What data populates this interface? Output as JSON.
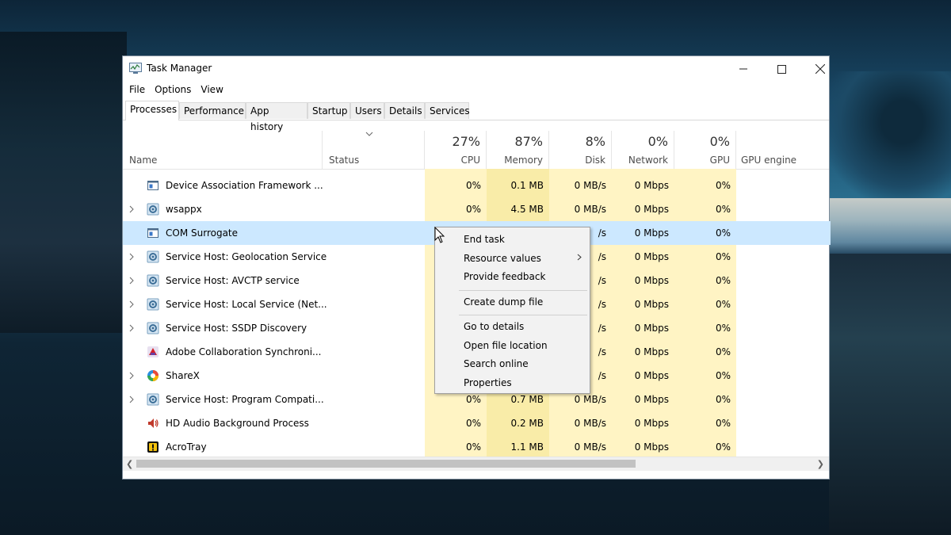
{
  "window": {
    "title": "Task Manager"
  },
  "menu": [
    "File",
    "Options",
    "View"
  ],
  "tabs": [
    "Processes",
    "Performance",
    "App history",
    "Startup",
    "Users",
    "Details",
    "Services"
  ],
  "columns": {
    "name": "Name",
    "status": "Status",
    "cpu": {
      "pct": "27%",
      "label": "CPU"
    },
    "memory": {
      "pct": "87%",
      "label": "Memory"
    },
    "disk": {
      "pct": "8%",
      "label": "Disk"
    },
    "network": {
      "pct": "0%",
      "label": "Network"
    },
    "gpu": {
      "pct": "0%",
      "label": "GPU"
    },
    "gpu_engine": "GPU engine"
  },
  "rows": [
    {
      "name": "Device Association Framework ...",
      "cpu": "0%",
      "memory": "0.1 MB",
      "disk": "0 MB/s",
      "network": "0 Mbps",
      "gpu": "0%",
      "icon": "window-icon",
      "expand": false
    },
    {
      "name": "wsappx",
      "cpu": "0%",
      "memory": "4.5 MB",
      "disk": "0 MB/s",
      "network": "0 Mbps",
      "gpu": "0%",
      "icon": "gear-icon",
      "expand": true
    },
    {
      "name": "COM Surrogate",
      "cpu": "",
      "memory": "",
      "disk": "/s",
      "network": "0 Mbps",
      "gpu": "0%",
      "icon": "window-icon",
      "expand": false,
      "selected": true
    },
    {
      "name": "Service Host: Geolocation Service",
      "cpu": "",
      "memory": "",
      "disk": "/s",
      "network": "0 Mbps",
      "gpu": "0%",
      "icon": "gear-icon",
      "expand": true
    },
    {
      "name": "Service Host: AVCTP service",
      "cpu": "",
      "memory": "",
      "disk": "/s",
      "network": "0 Mbps",
      "gpu": "0%",
      "icon": "gear-icon",
      "expand": true
    },
    {
      "name": "Service Host: Local Service (Net...",
      "cpu": "",
      "memory": "",
      "disk": "/s",
      "network": "0 Mbps",
      "gpu": "0%",
      "icon": "gear-icon",
      "expand": true
    },
    {
      "name": "Service Host: SSDP Discovery",
      "cpu": "",
      "memory": "",
      "disk": "/s",
      "network": "0 Mbps",
      "gpu": "0%",
      "icon": "gear-icon",
      "expand": true
    },
    {
      "name": "Adobe Collaboration Synchroni...",
      "cpu": "",
      "memory": "",
      "disk": "/s",
      "network": "0 Mbps",
      "gpu": "0%",
      "icon": "adobe-icon",
      "expand": false
    },
    {
      "name": "ShareX",
      "cpu": "",
      "memory": "",
      "disk": "/s",
      "network": "0 Mbps",
      "gpu": "0%",
      "icon": "sharex-icon",
      "expand": true
    },
    {
      "name": "Service Host: Program Compati...",
      "cpu": "0%",
      "memory": "0.7 MB",
      "disk": "0 MB/s",
      "network": "0 Mbps",
      "gpu": "0%",
      "icon": "gear-icon",
      "expand": true
    },
    {
      "name": "HD Audio Background Process",
      "cpu": "0%",
      "memory": "0.2 MB",
      "disk": "0 MB/s",
      "network": "0 Mbps",
      "gpu": "0%",
      "icon": "speaker-icon",
      "expand": false
    },
    {
      "name": "AcroTray",
      "cpu": "0%",
      "memory": "1.1 MB",
      "disk": "0 MB/s",
      "network": "0 Mbps",
      "gpu": "0%",
      "icon": "acrotray-icon",
      "expand": false
    }
  ],
  "context_menu": {
    "items": [
      {
        "label": "End task"
      },
      {
        "label": "Resource values",
        "submenu": true
      },
      {
        "label": "Provide feedback"
      },
      {
        "label": "Create dump file"
      },
      {
        "label": "Go to details"
      },
      {
        "label": "Open file location"
      },
      {
        "label": "Search online"
      },
      {
        "label": "Properties"
      }
    ]
  },
  "colors": {
    "selected_row": "#cce8ff",
    "cpu_heat": "#fff4c4",
    "memory_heat": "#f9eca8"
  }
}
